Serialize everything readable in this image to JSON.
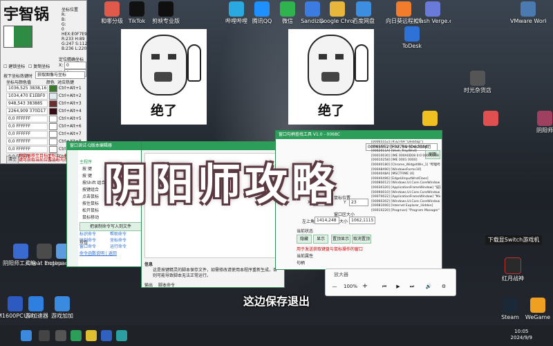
{
  "desktop_icons": [
    {
      "label": "和哪分级",
      "x": "150",
      "color": "#e05a4b"
    },
    {
      "label": "TikTok",
      "x": "186",
      "color": "#111111"
    },
    {
      "label": "剪映专业版",
      "x": "228",
      "color": "#0f0f0f"
    },
    {
      "label": "哔哩哔哩",
      "x": "330",
      "color": "#2aa8e0"
    },
    {
      "label": "腾讯QQ",
      "x": "367",
      "color": "#1e90ff"
    },
    {
      "label": "微信",
      "x": "404",
      "color": "#2fb34e"
    },
    {
      "label": "Sandizip",
      "x": "440",
      "color": "#3c7be0"
    },
    {
      "label": "Google Chrome",
      "x": "476",
      "color": "#e8b63a"
    },
    {
      "label": "百度网盘",
      "x": "514",
      "color": "#3c8fe0"
    },
    {
      "label": "向日葵远程控制",
      "x": "572",
      "color": "#f07c2c"
    },
    {
      "label": "Clash Verge.exe",
      "x": "614",
      "color": "#6a7ad8"
    },
    {
      "label": "VMware Workstation",
      "x": "752",
      "color": "#4a7ab0"
    },
    {
      "label": "ToDesk",
      "x": "584",
      "color": "#2e72d8",
      "row2": true
    }
  ],
  "left_icons": [
    {
      "label": "阴阳师工具箱 2022",
      "y": "378"
    },
    {
      "label": "UU加速器",
      "y": "412"
    },
    {
      "label": "Cheat Engine",
      "y": "378"
    },
    {
      "label": "notepad 快捷方式",
      "y": "378"
    },
    {
      "label": "游戏加加",
      "y": "438"
    },
    {
      "label": "M1600PC 游戏盒",
      "y": "438"
    }
  ],
  "right_icons": [
    {
      "label": "时光杂货店",
      "y": "120"
    },
    {
      "label": "阴阳师",
      "y": "176"
    },
    {
      "label": "下载显Switch游戏机",
      "y": "354"
    },
    {
      "label": "红月战神",
      "y": "380"
    },
    {
      "label": "Steam",
      "y": "438"
    },
    {
      "label": "WeGame",
      "y": "438"
    }
  ],
  "picker": {
    "brand": "宇智锅",
    "readout": [
      "坐标位置",
      "R:",
      "B:",
      "G:",
      "0",
      "HEX:E0F7E9",
      "R:233 H:89",
      "G:247 S:112",
      "B:236 L:220"
    ],
    "precision_label": "定位精确坐标",
    "x_label": "X:",
    "x_value": "0",
    "y_label": "Y:",
    "y_value": "0",
    "opt1": "建锁坐标",
    "opt2": "复制坐标",
    "opt3": "缩放倍率",
    "zoom": "1",
    "hotkey_hint": "按下坐标热键时",
    "hotkey_mode": "获取图像与坐标",
    "col_coord": "坐标与颜色值",
    "col_color": "颜色",
    "col_key": "对应热键",
    "rows": [
      {
        "coord": "1036,525 3838,16",
        "color": "#3a7a2c",
        "key": "Ctrl+Alt+1"
      },
      {
        "coord": "1034,470 E1EBF0",
        "color": "#e1ebf0",
        "key": "Ctrl+Alt+2"
      },
      {
        "coord": "948,543 383885",
        "color": "#6a2f2f",
        "key": "Ctrl+Alt+3"
      },
      {
        "coord": "2264,909 370D17",
        "color": "#370d17",
        "key": "Ctrl+Alt+4"
      },
      {
        "coord": "0,0 FFFFFF",
        "color": "#ffffff",
        "key": "Ctrl+Alt+5"
      },
      {
        "coord": "0,0 FFFFFF",
        "color": "#ffffff",
        "key": "Ctrl+Alt+6"
      },
      {
        "coord": "0,0 FFFFFF",
        "color": "#ffffff",
        "key": "Ctrl+Alt+7"
      },
      {
        "coord": "0,0 FFFFFF",
        "color": "#ffffff",
        "key": "Ctrl+Alt+8"
      },
      {
        "coord": "0,0 FFFFFF",
        "color": "#ffffff",
        "key": "Ctrl+Alt+9"
      },
      {
        "coord": "0,0 FFFFFF",
        "color": "#ffffff",
        "key": "Ctrl+Alt+0"
      }
    ],
    "clear_btn": "清空",
    "footer": "把鼠标移至目标坐标上，按下快捷键可获取当前位置坐标与颜色值"
  },
  "memes": [
    {
      "caption": "绝了"
    },
    {
      "caption": "绝了"
    }
  ],
  "script_window": {
    "title": "窗口调试-Q版本编辑器",
    "items": [
      "按 键",
      "按 键",
      "按Shift 组合键",
      "按键组合",
      "点击鼠标",
      "按住鼠标",
      "松开鼠标",
      "鼠标移动"
    ],
    "main_label": "主程序",
    "record_btn": "把录制命令写入到文件",
    "save_btn": "保存",
    "links": [
      "标识命令",
      "帮助命令",
      "时刻命令",
      "坐标命令",
      "窗口命令",
      "运行命令"
    ],
    "bottom_links": "命令函数说明 | 返回",
    "info_label": "信息",
    "info_text": "这是按键精灵的脚本保存文件，如需修改请使用本程序重新生成，否则可能导致脚本无法正常运行。",
    "tabs": [
      "输出",
      "脚本命令"
    ]
  },
  "handle_window": {
    "title": "窗口句柄查找工具 V1.0 - 0068C",
    "handle_value": "00065552 [F32769 (Desktop)]",
    "refresh_btn": "刷新",
    "class_label": "类名",
    "pos_label": "鼠标位置",
    "x_label": "X",
    "x_value": "239",
    "y_label": "Y",
    "y_value": "23",
    "size_label": "窗口区大小",
    "topleft_label": "左上角",
    "topleft_value": "1414,248",
    "size2_label": "大小",
    "size2_value": "1062,1115",
    "state_label": "当前状态",
    "btn_hide": "隐藏",
    "btn_show": "显示",
    "btn_top": "置顶显示",
    "btn_untop": "取消置顶",
    "note": "用于发送获取键盘与鼠标操作的窗口",
    "attr_label": "当前属性",
    "field_labels": [
      "句柄",
      "类名",
      "标题"
    ],
    "tree": [
      "[00065552] [#32769 \"Desktop\"]",
      "  [00030472] [Shell_TrayWnd] \"任务栏\"",
      "  [0002011A] [Shell_TrayWnd]",
      "  [00010030] [IME 000A0D08 0:0 0000000B 000000F6]",
      "  [00010258] [IME 0001 0000]",
      "  [00040180] [Chrome_WidgetWin_1] \"哔哩哔哩\"",
      "  [00048490] [WindowsForms10]",
      "  [0004048A] [MSCTFIME UI]",
      "  [00040496] [EdgeUiInputWndClass]",
      "  [00080012] [Windows.UI.Core.CoreWindow]",
      "  [00030320] [ApplicationFrameWindow] \"设置\"",
      "  [00090010] [Windows.UI.Core.CoreWindow] \"设置\"",
      "  [00070022] [ApplicationFrameWindow] \"Microsoft Store\"",
      "  [00060302] [Windows.UI.Core.CoreWindow]",
      "  [00081000] [Internet Explorer_Hidden]",
      "  [00010220] [Progman] \"Program Manager\""
    ]
  },
  "overlay": {
    "title": "阴阳师攻略",
    "subtitle": "这边保存退出"
  },
  "player": {
    "title": "放大器",
    "zoom": "100%",
    "minus": "—",
    "plus": "+"
  },
  "taskbar": {
    "time": "10:05",
    "date": "2024/9/9"
  }
}
